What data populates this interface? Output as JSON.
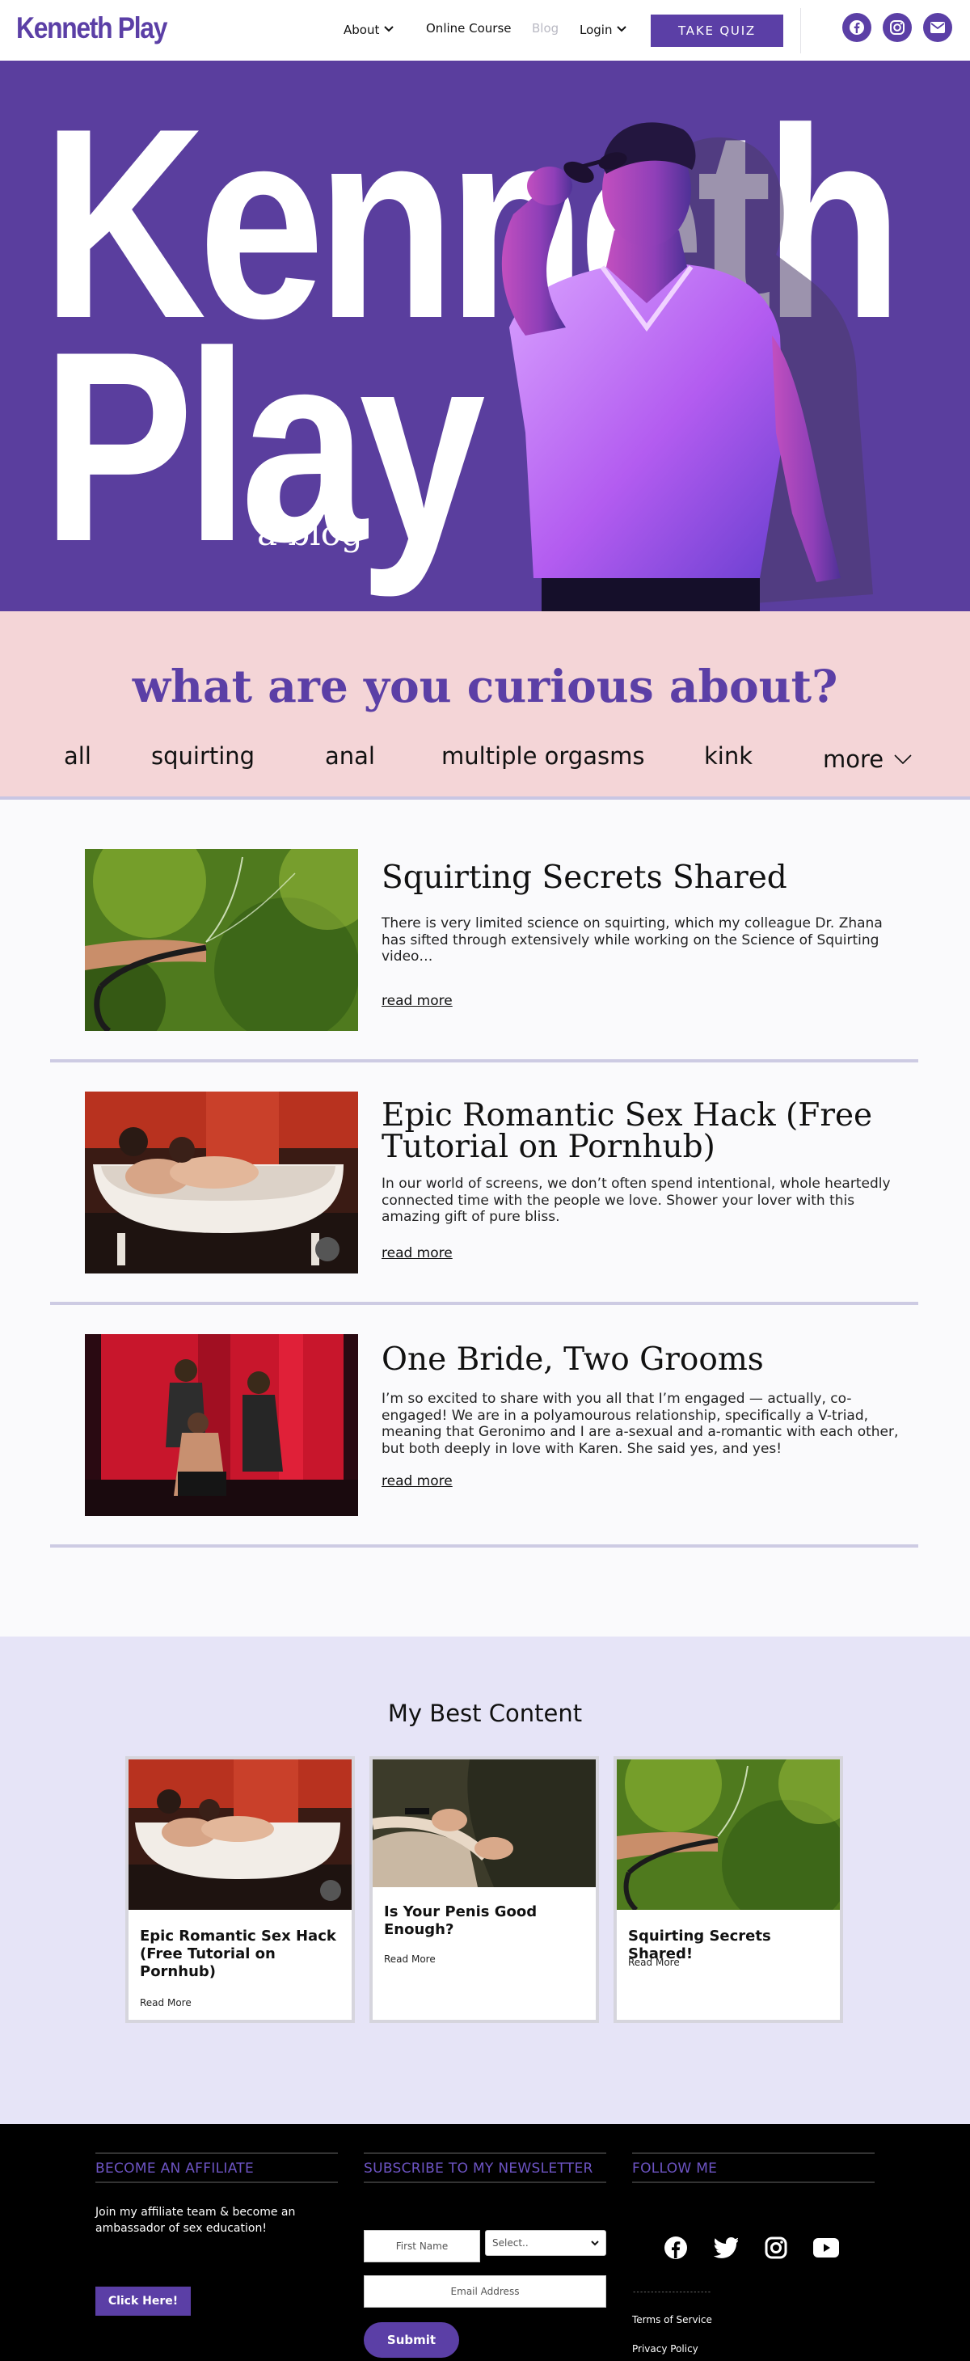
{
  "header": {
    "logo": "Kenneth Play",
    "nav": {
      "about": "About",
      "online_course": "Online Course",
      "blog": "Blog",
      "login": "Login"
    },
    "cta": "TAKE QUIZ",
    "social_icons": [
      "facebook-icon",
      "instagram-icon",
      "mail-icon"
    ],
    "accent_color": "#5b3fa6"
  },
  "hero": {
    "title_line1": "Kenneth",
    "title_line2": "Play",
    "subtitle": "a blog",
    "background_color": "#5a3e9e"
  },
  "curious": {
    "title": "what are you curious about?",
    "topics": [
      "all",
      "squirting",
      "anal",
      "multiple orgasms",
      "kink",
      "more"
    ],
    "background_color": "#f4d5d7"
  },
  "posts": [
    {
      "title": "Squirting Secrets Shared",
      "excerpt": "There is very limited science on squirting, which my colleague Dr. Zhana has sifted through extensively while working on the Science of Squirting video…",
      "read_more": "read more"
    },
    {
      "title": "Epic Romantic Sex Hack (Free Tutorial on Pornhub)",
      "excerpt": "In our world of screens, we don’t often spend intentional, whole heartedly connected time with the people we love. Shower your lover with this amazing gift of pure bliss.",
      "read_more": "read more"
    },
    {
      "title": "One Bride, Two Grooms",
      "excerpt": "I’m so excited to share with you all that I’m engaged — actually, co-engaged! We are in a polyamourous relationship, specifically a V-triad, meaning that Geronimo and I are a-sexual and a-romantic with each other, but both deeply in love with Karen. She said yes, and yes!",
      "read_more": "read more"
    }
  ],
  "best": {
    "title": "My Best Content",
    "cards": [
      {
        "title": "Epic Romantic Sex Hack (Free Tutorial on Pornhub)",
        "read_more": "Read More"
      },
      {
        "title": "Is Your Penis Good Enough?",
        "read_more": "Read More"
      },
      {
        "title": "Squirting Secrets Shared!",
        "read_more": "Read More"
      }
    ],
    "background_color": "#e6e4f7"
  },
  "footer": {
    "affiliate": {
      "heading": "BECOME AN AFFILIATE",
      "text": "Join my affiliate team & become an ambassador of sex education!",
      "button": "Click Here!"
    },
    "newsletter": {
      "heading": "SUBSCRIBE TO MY NEWSLETTER",
      "first_name_placeholder": "First Name",
      "select_value": "Select..",
      "email_placeholder": "Email Address",
      "submit": "Submit"
    },
    "follow": {
      "heading": "FOLLOW ME",
      "icons": [
        "facebook-icon",
        "twitter-icon",
        "instagram-icon",
        "youtube-icon"
      ],
      "divider": "----------------------",
      "terms": "Terms of Service",
      "privacy": "Privacy Policy"
    }
  }
}
